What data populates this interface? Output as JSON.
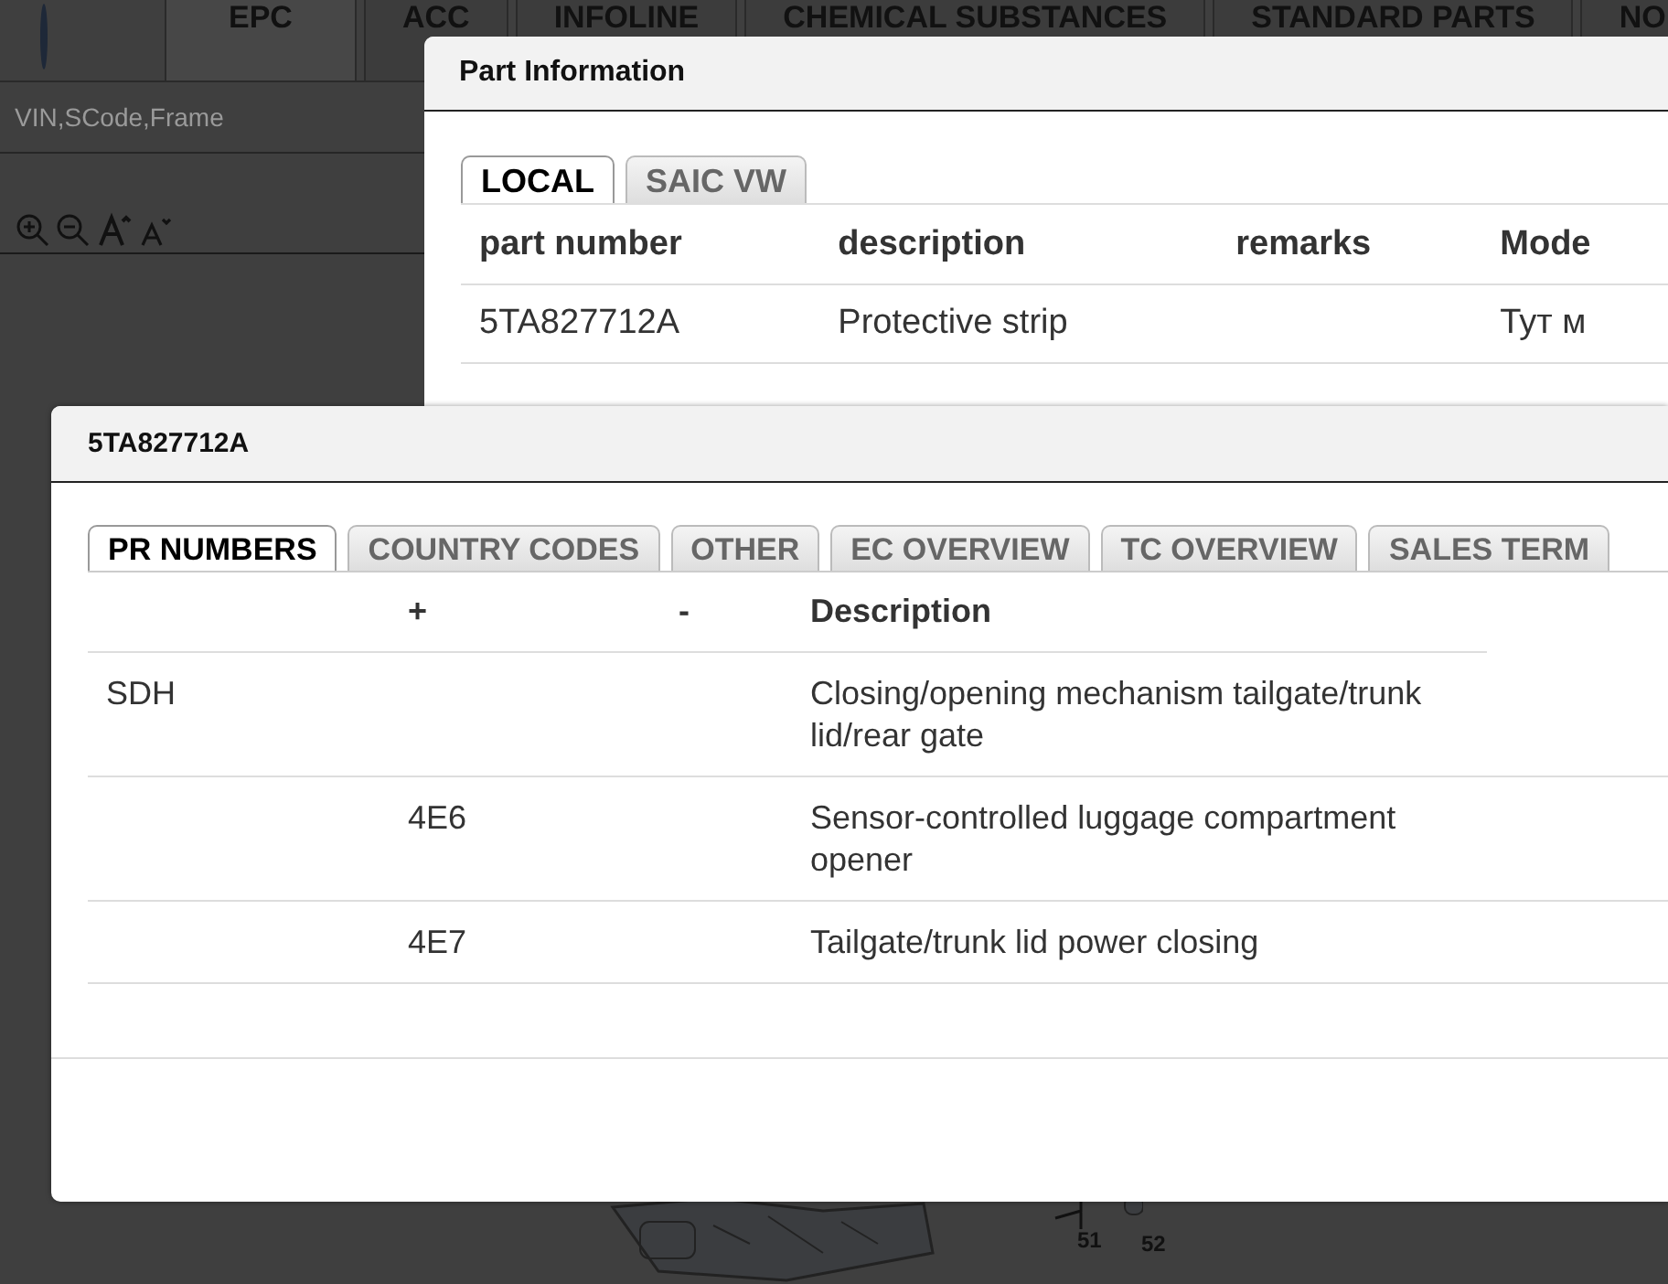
{
  "app": {
    "tabs": [
      {
        "label": "EPC",
        "selected": true
      },
      {
        "label": "ACC",
        "selected": false
      },
      {
        "label": "INFOLINE",
        "selected": false
      },
      {
        "label": "CHEMICAL SUBSTANCES",
        "selected": false
      },
      {
        "label": "STANDARD PARTS",
        "selected": false
      },
      {
        "label": "NO",
        "selected": false
      }
    ],
    "search": {
      "placeholder": "VIN,SCode,Frame"
    },
    "diagram": {
      "callouts": [
        "51",
        "52"
      ]
    }
  },
  "part_information": {
    "title": "Part Information",
    "tabs": [
      {
        "label": "LOCAL",
        "selected": true
      },
      {
        "label": "SAIC VW",
        "selected": false
      }
    ],
    "columns": [
      "part number",
      "description",
      "remarks",
      "Mode"
    ],
    "rows": [
      {
        "part_number": "5TA827712A",
        "description": "Protective strip",
        "column_4": "Тут м"
      }
    ]
  },
  "pr_dialog": {
    "title": "5TA827712A",
    "tabs": [
      {
        "label": "PR NUMBERS",
        "selected": true
      },
      {
        "label": "COUNTRY CODES",
        "selected": false
      },
      {
        "label": "OTHER",
        "selected": false
      },
      {
        "label": "EC OVERVIEW",
        "selected": false
      },
      {
        "label": "TC OVERVIEW",
        "selected": false
      },
      {
        "label": "SALES TERM",
        "selected": false
      }
    ],
    "columns": [
      "+",
      "-",
      "Description"
    ],
    "rows": [
      {
        "column_1": "SDH",
        "description": "Closing/opening mechanism tailgate/trunk lid/rear gate"
      },
      {
        "plus": "4E6",
        "description": "Sensor-controlled luggage compartment opener"
      },
      {
        "plus": "4E7",
        "description": "Tailgate/trunk lid power closing"
      }
    ]
  }
}
